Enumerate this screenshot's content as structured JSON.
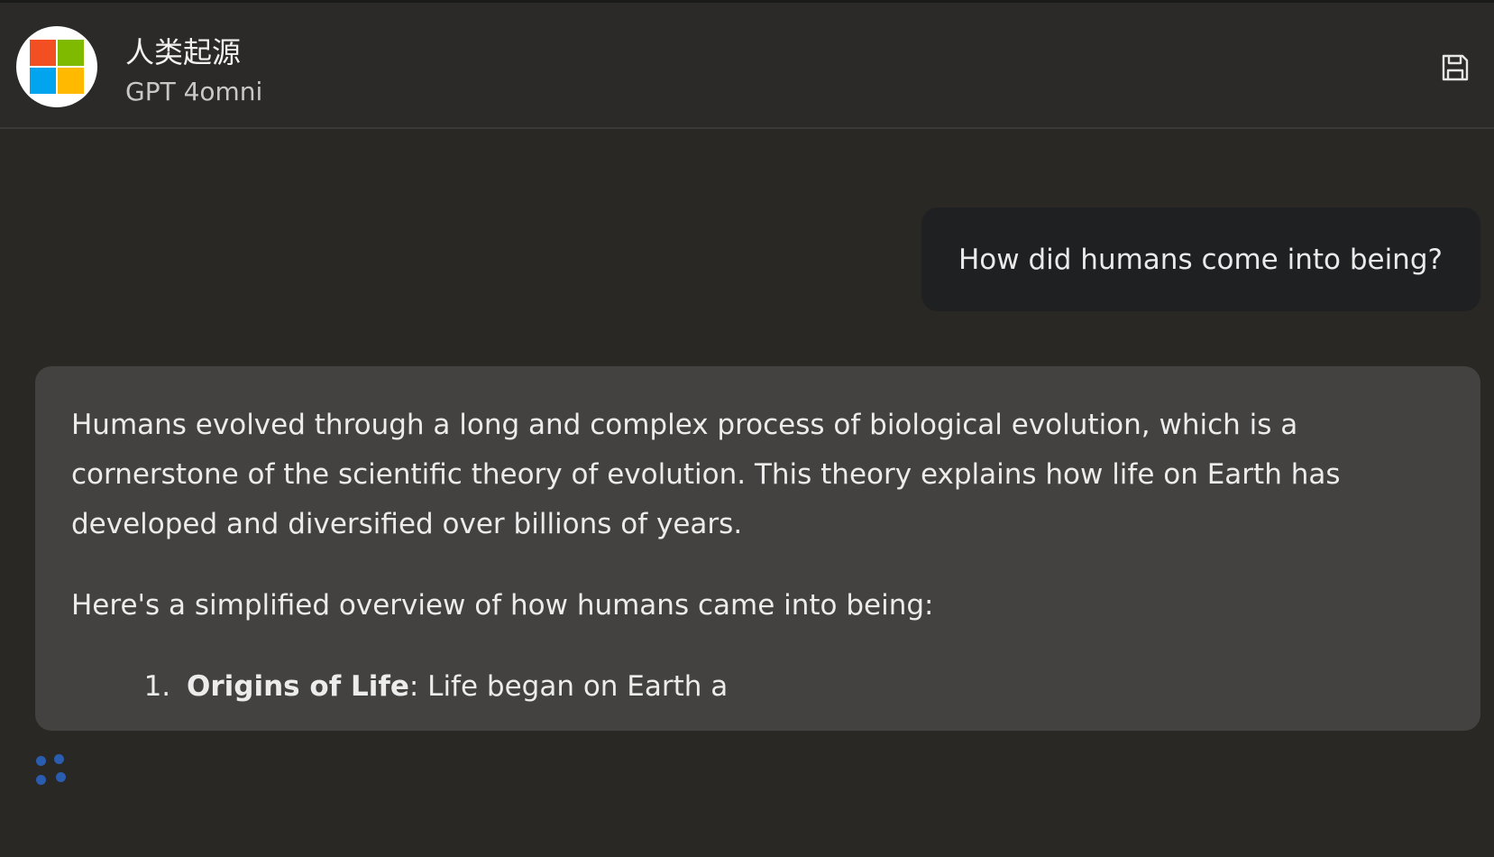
{
  "header": {
    "title": "人类起源",
    "model": "GPT 4omni",
    "avatar_icon": "windows-logo-icon",
    "save_icon": "floppy-disk-icon",
    "logo_colors": [
      "#f25022",
      "#7fba00",
      "#00a4ef",
      "#ffb900"
    ]
  },
  "chat": {
    "user_message": "How did humans come into being?",
    "assistant": {
      "paragraph1": "Humans evolved through a long and complex process of biological evolution, which is a cornerstone of the scientific theory of evolution. This theory explains how life on Earth has developed and diversified over billions of years.",
      "paragraph2": "Here's a simplified overview of how humans came into being:",
      "list": [
        {
          "title": "Origins of Life",
          "text": ": Life began on Earth a"
        }
      ]
    },
    "loading_icon": "loading-dots-icon",
    "loading_color": "#2a5db0"
  }
}
